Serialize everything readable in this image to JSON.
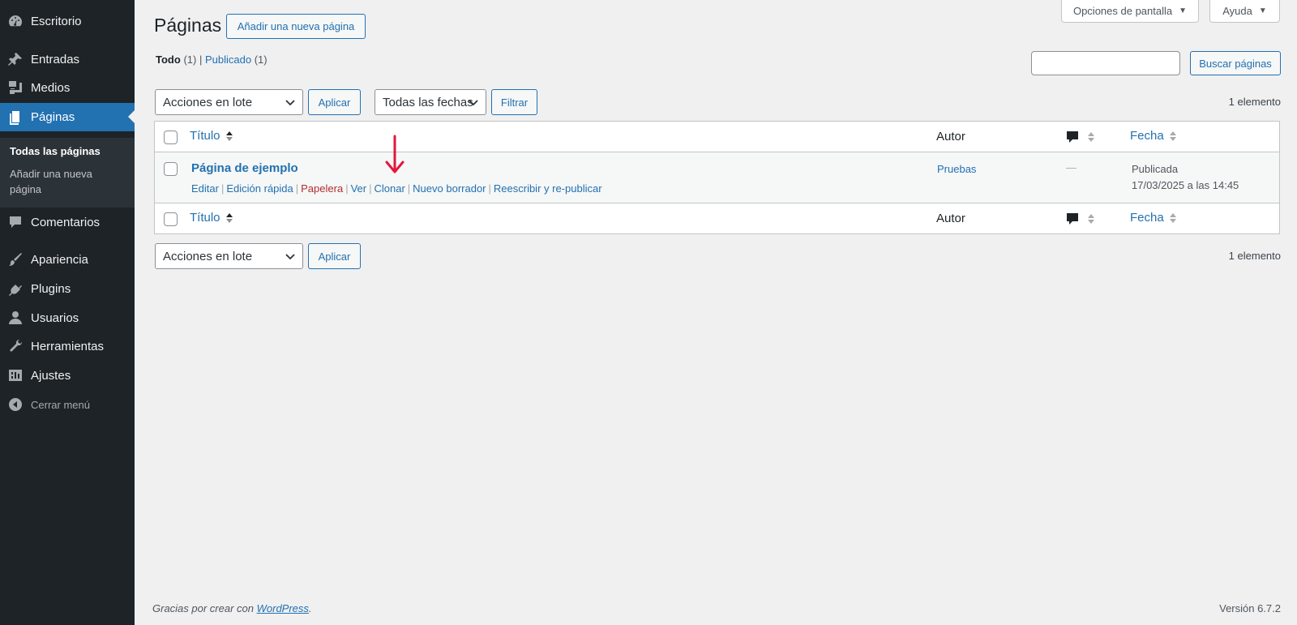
{
  "sidebar": {
    "items": [
      {
        "label": "Escritorio",
        "icon": "dashboard-icon"
      },
      {
        "label": "Entradas",
        "icon": "pin-icon"
      },
      {
        "label": "Medios",
        "icon": "media-icon"
      },
      {
        "label": "Páginas",
        "icon": "pages-icon"
      },
      {
        "label": "Comentarios",
        "icon": "comments-icon"
      },
      {
        "label": "Apariencia",
        "icon": "brush-icon"
      },
      {
        "label": "Plugins",
        "icon": "plugin-icon"
      },
      {
        "label": "Usuarios",
        "icon": "user-icon"
      },
      {
        "label": "Herramientas",
        "icon": "wrench-icon"
      },
      {
        "label": "Ajustes",
        "icon": "settings-icon"
      }
    ],
    "submenu": {
      "all_pages": "Todas las páginas",
      "add_new": "Añadir una nueva página"
    },
    "collapse_label": "Cerrar menú"
  },
  "header": {
    "screen_options": "Opciones de pantalla",
    "help": "Ayuda",
    "title": "Páginas",
    "add_new": "Añadir una nueva página"
  },
  "filters": {
    "all_label": "Todo",
    "all_count": "(1)",
    "published_label": "Publicado",
    "published_count": "(1)",
    "search_button": "Buscar páginas",
    "search_value": ""
  },
  "tablenav_top": {
    "bulk_actions": "Acciones en lote",
    "apply": "Aplicar",
    "dates": "Todas las fechas",
    "filter": "Filtrar",
    "count": "1 elemento"
  },
  "table": {
    "columns": {
      "title": "Título",
      "author": "Autor",
      "date": "Fecha"
    },
    "rows": [
      {
        "title": "Página de ejemplo",
        "author": "Pruebas",
        "comments": "—",
        "status": "Publicada",
        "date": "17/03/2025 a las 14:45",
        "actions": {
          "edit": "Editar",
          "quick_edit": "Edición rápida",
          "trash": "Papelera",
          "view": "Ver",
          "clone": "Clonar",
          "new_draft": "Nuevo borrador",
          "rewrite": "Reescribir y re-publicar"
        }
      }
    ]
  },
  "tablenav_bottom": {
    "bulk_actions": "Acciones en lote",
    "apply": "Aplicar",
    "count": "1 elemento"
  },
  "footer": {
    "thanks_prefix": "Gracias por crear con ",
    "wordpress_link": "WordPress",
    "thanks_suffix": ".",
    "version": "Versión 6.7.2"
  },
  "colors": {
    "sidebar_bg": "#1d2327",
    "accent": "#2271b1",
    "trash": "#b32d2e",
    "annotation_arrow": "#e0193c"
  }
}
